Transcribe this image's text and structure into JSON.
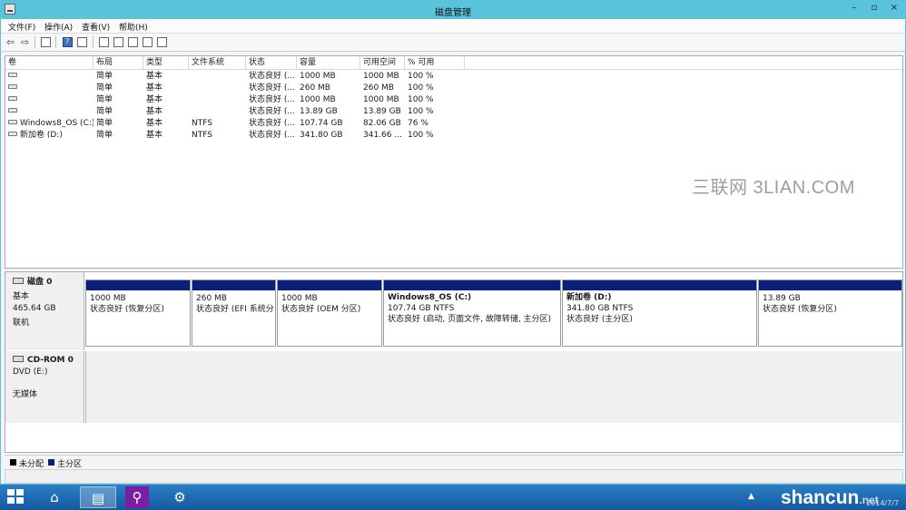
{
  "window": {
    "title": "磁盘管理"
  },
  "window_controls": {
    "minimize": "–",
    "maximize": "▫",
    "close": "×"
  },
  "menu": [
    "文件(F)",
    "操作(A)",
    "查看(V)",
    "帮助(H)"
  ],
  "columns": [
    "卷",
    "布局",
    "类型",
    "文件系统",
    "状态",
    "容量",
    "可用空间",
    "% 可用"
  ],
  "volumes": [
    {
      "name": "",
      "layout": "简单",
      "type": "基本",
      "fs": "",
      "status": "状态良好 (...",
      "capacity": "1000 MB",
      "free": "1000 MB",
      "pct": "100 %"
    },
    {
      "name": "",
      "layout": "简单",
      "type": "基本",
      "fs": "",
      "status": "状态良好 (...",
      "capacity": "260 MB",
      "free": "260 MB",
      "pct": "100 %"
    },
    {
      "name": "",
      "layout": "简单",
      "type": "基本",
      "fs": "",
      "status": "状态良好 (...",
      "capacity": "1000 MB",
      "free": "1000 MB",
      "pct": "100 %"
    },
    {
      "name": "",
      "layout": "简单",
      "type": "基本",
      "fs": "",
      "status": "状态良好 (...",
      "capacity": "13.89 GB",
      "free": "13.89 GB",
      "pct": "100 %"
    },
    {
      "name": "Windows8_OS (C:)",
      "layout": "简单",
      "type": "基本",
      "fs": "NTFS",
      "status": "状态良好 (...",
      "capacity": "107.74 GB",
      "free": "82.06 GB",
      "pct": "76 %"
    },
    {
      "name": "新加卷 (D:)",
      "layout": "简单",
      "type": "基本",
      "fs": "NTFS",
      "status": "状态良好 (...",
      "capacity": "341.80 GB",
      "free": "341.66 ...",
      "pct": "100 %"
    }
  ],
  "watermark": "三联网 3LIAN.COM",
  "disk0": {
    "name": "磁盘 0",
    "type": "基本",
    "size": "465.64 GB",
    "state": "联机",
    "partitions": [
      {
        "name": "",
        "size": "1000 MB",
        "status": "状态良好 (恢复分区)"
      },
      {
        "name": "",
        "size": "260 MB",
        "status": "状态良好 (EFI 系统分"
      },
      {
        "name": "",
        "size": "1000 MB",
        "status": "状态良好 (OEM 分区)"
      },
      {
        "name": "Windows8_OS  (C:)",
        "size": "107.74 GB NTFS",
        "status": "状态良好 (启动, 页面文件, 故障转储, 主分区)"
      },
      {
        "name": "新加卷  (D:)",
        "size": "341.80 GB NTFS",
        "status": "状态良好 (主分区)"
      },
      {
        "name": "",
        "size": "13.89 GB",
        "status": "状态良好 (恢复分区)"
      }
    ]
  },
  "cdrom0": {
    "name": "CD-ROM 0",
    "drive": "DVD (E:)",
    "media": "无媒体"
  },
  "legend": [
    {
      "label": "未分配",
      "color": "#000000"
    },
    {
      "label": "主分区",
      "color": "#0b1f7a"
    }
  ],
  "taskbar": {
    "tray_arrow": "▲",
    "brand": "shancun",
    "brand_tld": ".net",
    "date": "2014/7/7"
  }
}
